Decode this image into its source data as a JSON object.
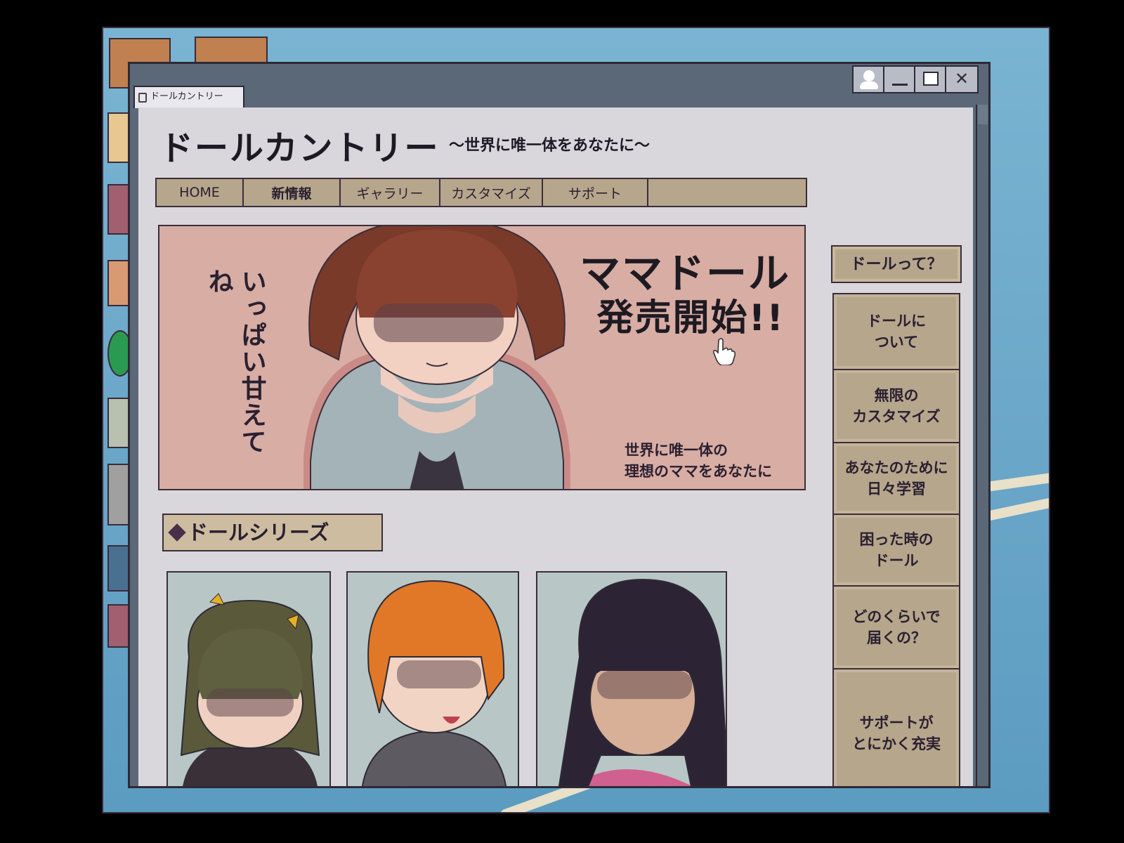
{
  "window": {
    "tab_title": "ドールカントリー"
  },
  "site": {
    "title": "ドールカントリー",
    "tagline": "〜世界に唯一体をあなたに〜"
  },
  "nav": {
    "items": [
      "HOME",
      "新情報",
      "ギャラリー",
      "カスタマイズ",
      "サポート"
    ]
  },
  "banner": {
    "vertical_text": "いっぱい甘えてね",
    "headline_1": "ママドール",
    "headline_2": "発売開始!!",
    "subtext_1": "世界に唯一体の",
    "subtext_2": "理想のママをあなたに"
  },
  "series": {
    "header": "ドールシリーズ"
  },
  "side": {
    "what_button": "ドールって？",
    "items": [
      "ドールに\nついて",
      "無限の\nカスタマイズ",
      "あなたのために\n日々学習",
      "困った時の\nドール",
      "どのくらいで\n届くの？",
      "サポートが\nとにかく充実"
    ]
  },
  "colors": {
    "desktop_bg": "#6aa6c8",
    "window_frame": "#5a6878",
    "page_bg": "#d9d7dc",
    "nav_bg": "#b6a68c",
    "banner_bg": "#d8ada4",
    "card_bg": "#b8c7c6"
  },
  "icons": [
    "tab-page-icon",
    "user-icon",
    "minimize-icon",
    "maximize-icon",
    "close-icon",
    "pointer-hand-icon",
    "folder-icon"
  ]
}
